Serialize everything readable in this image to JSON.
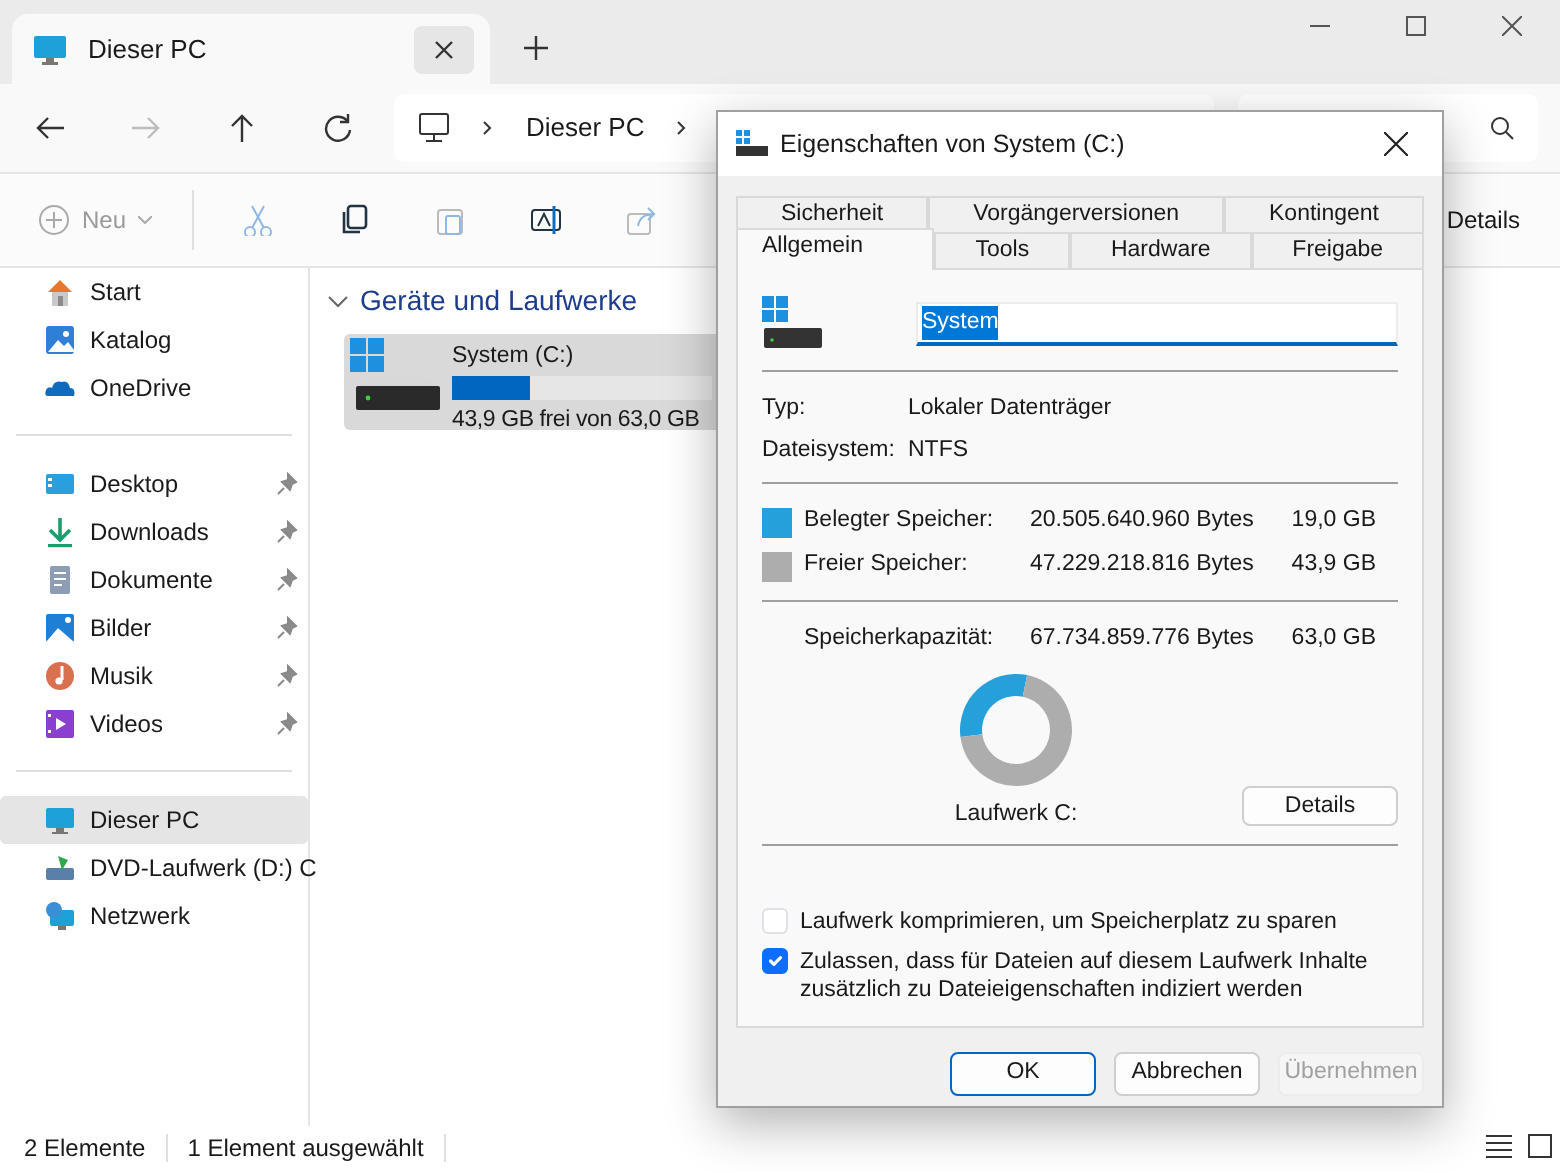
{
  "tab": {
    "title": "Dieser PC",
    "selected": true
  },
  "navigation": {
    "forward_disabled": true
  },
  "breadcrumb": [
    "Dieser PC"
  ],
  "toolbar": {
    "new_label": "Neu",
    "details_label": "Details"
  },
  "sidebar": {
    "groups": [
      [
        {
          "label": "Start",
          "kind": "home",
          "pinned": false,
          "selected": false
        },
        {
          "label": "Katalog",
          "kind": "gallery",
          "pinned": false,
          "selected": false
        },
        {
          "label": "OneDrive",
          "kind": "cloud",
          "pinned": false,
          "selected": false
        }
      ],
      [
        {
          "label": "Desktop",
          "kind": "desktop",
          "pinned": true,
          "selected": false
        },
        {
          "label": "Downloads",
          "kind": "download",
          "pinned": true,
          "selected": false
        },
        {
          "label": "Dokumente",
          "kind": "document",
          "pinned": true,
          "selected": false
        },
        {
          "label": "Bilder",
          "kind": "pictures",
          "pinned": true,
          "selected": false
        },
        {
          "label": "Musik",
          "kind": "music",
          "pinned": true,
          "selected": false
        },
        {
          "label": "Videos",
          "kind": "videos",
          "pinned": true,
          "selected": false
        }
      ],
      [
        {
          "label": "Dieser PC",
          "kind": "pc",
          "pinned": false,
          "selected": true
        },
        {
          "label": "DVD-Laufwerk (D:) C",
          "kind": "dvd",
          "pinned": false,
          "selected": false
        },
        {
          "label": "Netzwerk",
          "kind": "network",
          "pinned": false,
          "selected": false
        }
      ]
    ]
  },
  "content": {
    "heading": "Geräte und Laufwerke",
    "drives": [
      {
        "name": "System (C:)",
        "level": 0.3,
        "caption": "43,9 GB frei von 63,0 GB",
        "selected": true
      }
    ]
  },
  "status_bar": [
    "2 Elemente",
    "1 Element ausgewählt"
  ],
  "dialog": {
    "title": "Eigenschaften von System (C:)",
    "tab_rows": [
      [
        {
          "label": "Sicherheit",
          "selected": false
        },
        {
          "label": "Vorgängerversionen",
          "selected": false
        },
        {
          "label": "Kontingent",
          "selected": false
        }
      ],
      [
        {
          "label": "Allgemein",
          "selected": true
        },
        {
          "label": "Tools",
          "selected": false
        },
        {
          "label": "Hardware",
          "selected": false
        },
        {
          "label": "Freigabe",
          "selected": false
        }
      ]
    ],
    "name_value": "System",
    "info": [
      {
        "label": "Typ:",
        "value": "Lokaler Datenträger"
      },
      {
        "label": "Dateisystem:",
        "value": "NTFS"
      }
    ],
    "usage": [
      {
        "label": "Belegter Speicher:",
        "bytes": "20.505.640.960 Bytes",
        "size": "19,0 GB",
        "color": "#26a0da"
      },
      {
        "label": "Freier Speicher:",
        "bytes": "47.229.218.816 Bytes",
        "size": "43,9 GB",
        "color": "#adadad"
      }
    ],
    "capacity": {
      "label": "Speicherkapazität:",
      "bytes": "67.734.859.776 Bytes",
      "size": "63,0 GB"
    },
    "chart_data": {
      "type": "donut",
      "values": [
        30.2,
        69.8
      ]
    },
    "drive_label": "Laufwerk C:",
    "details_button": "Details",
    "options": [
      {
        "label": "Laufwerk komprimieren, um Speicherplatz zu sparen",
        "checked": false
      },
      {
        "label": "Zulassen, dass für Dateien auf diesem Laufwerk Inhalte zusätzlich zu Dateieigenschaften indiziert werden",
        "checked": true
      }
    ],
    "buttons": [
      {
        "label": "OK",
        "default": true,
        "disabled": false
      },
      {
        "label": "Abbrechen",
        "default": false,
        "disabled": false
      },
      {
        "label": "Übernehmen",
        "default": false,
        "disabled": true
      }
    ]
  }
}
